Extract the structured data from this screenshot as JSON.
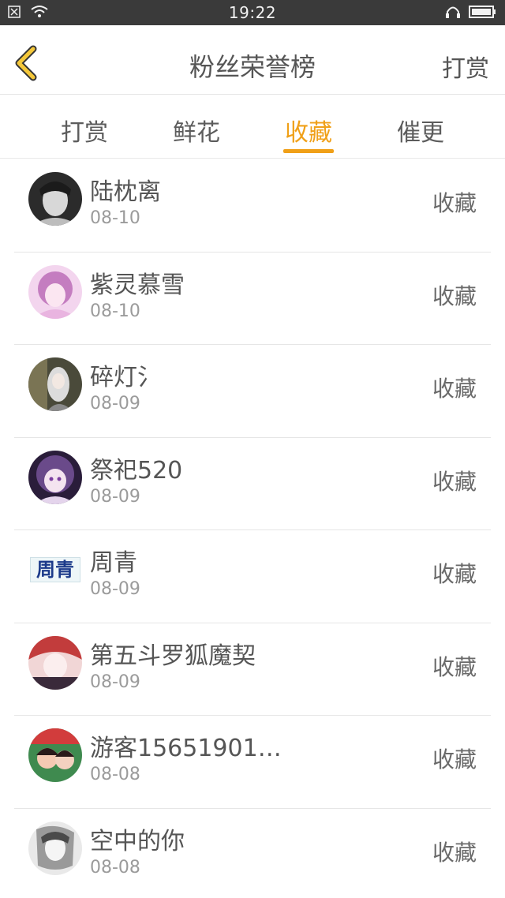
{
  "status_bar": {
    "time": "19:22"
  },
  "header": {
    "title": "粉丝荣誉榜",
    "action_label": "打赏"
  },
  "tabs": [
    {
      "label": "打赏",
      "active": false
    },
    {
      "label": "鲜花",
      "active": false
    },
    {
      "label": "收藏",
      "active": true
    },
    {
      "label": "催更",
      "active": false
    }
  ],
  "list": [
    {
      "name": "陆枕离",
      "date": "08-10",
      "action": "收藏",
      "avatar": "photo-avatar"
    },
    {
      "name": "紫灵慕雪",
      "date": "08-10",
      "action": "收藏",
      "avatar": "anime-avatar"
    },
    {
      "name": "碎灯氵",
      "date": "08-09",
      "action": "收藏",
      "avatar": "photo-avatar"
    },
    {
      "name": "祭祀520",
      "date": "08-09",
      "action": "收藏",
      "avatar": "anime-avatar"
    },
    {
      "name": "周青",
      "date": "08-09",
      "action": "收藏",
      "avatar": "text-avatar",
      "avatar_text": "周青"
    },
    {
      "name": "第五斗罗狐魔契",
      "date": "08-09",
      "action": "收藏",
      "avatar": "anime-avatar"
    },
    {
      "name": "游客15651901…",
      "date": "08-08",
      "action": "收藏",
      "avatar": "photo-avatar"
    },
    {
      "name": "空中的你",
      "date": "08-08",
      "action": "收藏",
      "avatar": "photo-avatar"
    }
  ],
  "colors": {
    "accent": "#f0a018",
    "status_bar": "#3a3a3a",
    "text": "#555555",
    "secondary_text": "#9b9b9b"
  }
}
